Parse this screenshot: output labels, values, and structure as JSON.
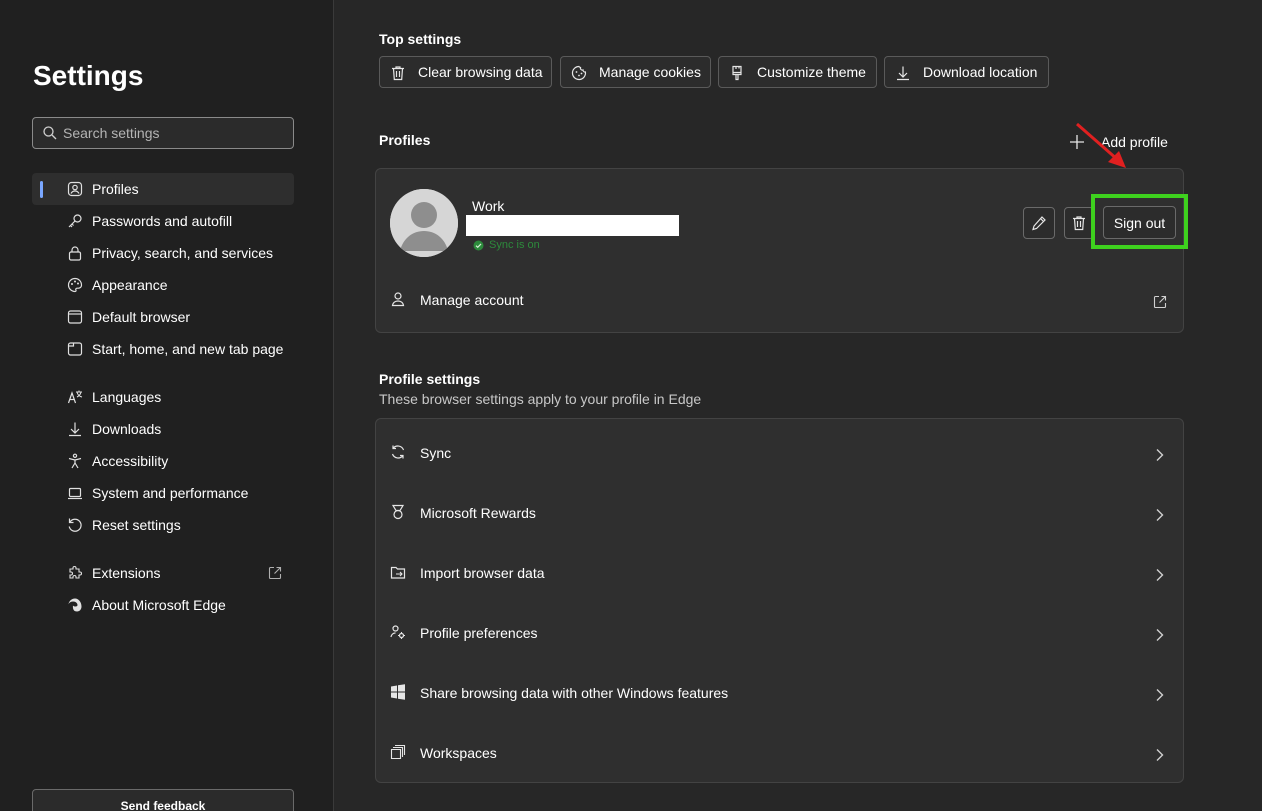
{
  "sidebar": {
    "title": "Settings",
    "search_placeholder": "Search settings",
    "items": [
      {
        "label": "Profiles",
        "icon": "profiles-icon",
        "active": true
      },
      {
        "label": "Passwords and autofill",
        "icon": "key-icon"
      },
      {
        "label": "Privacy, search, and services",
        "icon": "lock-icon"
      },
      {
        "label": "Appearance",
        "icon": "palette-icon"
      },
      {
        "label": "Default browser",
        "icon": "browser-icon"
      },
      {
        "label": "Start, home, and new tab page",
        "icon": "home-tab-icon"
      },
      {
        "label": "Languages",
        "icon": "language-icon"
      },
      {
        "label": "Downloads",
        "icon": "download-icon"
      },
      {
        "label": "Accessibility",
        "icon": "accessibility-icon"
      },
      {
        "label": "System and performance",
        "icon": "laptop-icon"
      },
      {
        "label": "Reset settings",
        "icon": "reset-icon"
      },
      {
        "label": "Extensions",
        "icon": "puzzle-icon"
      },
      {
        "label": "About Microsoft Edge",
        "icon": "edge-logo-icon"
      }
    ],
    "feedback_label": "Send feedback"
  },
  "top_settings": {
    "title": "Top settings",
    "buttons": [
      {
        "label": "Clear browsing data",
        "icon": "trash-icon"
      },
      {
        "label": "Manage cookies",
        "icon": "cookie-icon"
      },
      {
        "label": "Customize theme",
        "icon": "brush-icon"
      },
      {
        "label": "Download location",
        "icon": "download-icon"
      }
    ]
  },
  "profiles": {
    "title": "Profiles",
    "add_label": "Add profile",
    "profile_name": "Work",
    "sync_status": "Sync is on",
    "signout_label": "Sign out",
    "manage_account_label": "Manage account"
  },
  "profile_settings": {
    "title": "Profile settings",
    "subtitle": "These browser settings apply to your profile in Edge",
    "rows": [
      {
        "label": "Sync",
        "icon": "sync-icon"
      },
      {
        "label": "Microsoft Rewards",
        "icon": "rewards-medal-icon"
      },
      {
        "label": "Import browser data",
        "icon": "import-folder-icon"
      },
      {
        "label": "Profile preferences",
        "icon": "profile-preferences-icon"
      },
      {
        "label": "Share browsing data with other Windows features",
        "icon": "windows-logo-icon"
      },
      {
        "label": "Workspaces",
        "icon": "workspaces-icon"
      }
    ]
  },
  "colors": {
    "background": "#272727",
    "sidebar": "#202020",
    "card": "#2f2f2f",
    "accent": "#7aa7ff",
    "highlight": "#3ed11e",
    "annotation_arrow": "#e02020",
    "sync_green": "#2d8a3c"
  }
}
